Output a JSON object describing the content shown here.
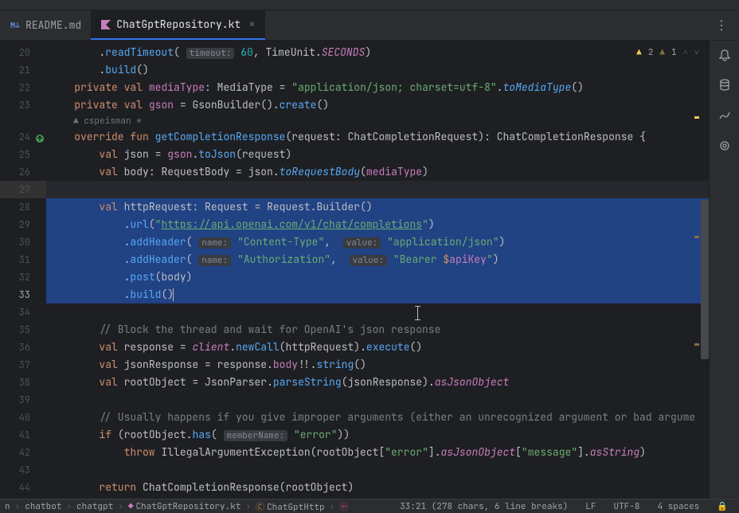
{
  "tabs": [
    {
      "label": "README.md",
      "icon": "M↓"
    },
    {
      "label": "ChatGptRepository.kt",
      "icon": "Kt"
    }
  ],
  "warnings": {
    "warn_count": "2",
    "weak_count": "1"
  },
  "author": {
    "name": "cspeisman",
    "flag": "*"
  },
  "gutter": [
    "20",
    "21",
    "22",
    "23",
    "24",
    "25",
    "26",
    "27",
    "28",
    "29",
    "30",
    "31",
    "32",
    "33",
    "34",
    "35",
    "36",
    "37",
    "38",
    "39",
    "40",
    "41",
    "42",
    "43",
    "44"
  ],
  "code": {
    "l20": {
      "fn": "readTimeout",
      "hint": "timeout:",
      "num": "60",
      "unit": "TimeUnit",
      "const": "SECONDS"
    },
    "l21": {
      "fn": "build"
    },
    "l22": {
      "kw1": "private",
      "kw2": "val",
      "name": "mediaType",
      "type": "MediaType",
      "str": "\"application/json; charset=utf-8\"",
      "ext": "toMediaType"
    },
    "l23": {
      "kw1": "private",
      "kw2": "val",
      "name": "gson",
      "builder": "GsonBuilder",
      "create": "create"
    },
    "l24": {
      "kw1": "override",
      "kw2": "fun",
      "fn": "getCompletionResponse",
      "p1": "request",
      "t1": "ChatCompletionRequest",
      "ret": "ChatCompletionResponse"
    },
    "l25": {
      "kw": "val",
      "name": "json",
      "obj": "gson",
      "fn": "toJson",
      "arg": "request"
    },
    "l26": {
      "kw": "val",
      "name": "body",
      "type": "RequestBody",
      "obj": "json",
      "ext": "toRequestBody",
      "arg": "mediaType"
    },
    "l28": {
      "kw": "val",
      "name": "httpRequest",
      "type": "Request",
      "builder": "Request.Builder"
    },
    "l29": {
      "fn": "url",
      "str": "https://api.openai.com/v1/chat/completions"
    },
    "l30": {
      "fn": "addHeader",
      "h1": "name:",
      "s1": "\"Content-Type\"",
      "h2": "value:",
      "s2": "\"application/json\""
    },
    "l31": {
      "fn": "addHeader",
      "h1": "name:",
      "s1": "\"Authorization\"",
      "h2": "value:",
      "s2a": "\"Bearer ",
      "tmpl": "$",
      "var": "apiKey",
      "s2b": "\""
    },
    "l32": {
      "fn": "post",
      "arg": "body"
    },
    "l33": {
      "fn": "build"
    },
    "l35": {
      "cmt": "// Block the thread and wait for OpenAI's json response"
    },
    "l36": {
      "kw": "val",
      "name": "response",
      "obj": "client",
      "fn1": "newCall",
      "arg": "httpRequest",
      "fn2": "execute"
    },
    "l37": {
      "kw": "val",
      "name": "jsonResponse",
      "obj": "response",
      "prop": "body",
      "nn": "!!",
      "fn": "string"
    },
    "l38": {
      "kw": "val",
      "name": "rootObject",
      "cls": "JsonParser",
      "fn": "parseString",
      "arg": "jsonResponse",
      "ext": "asJsonObject"
    },
    "l40": {
      "cmt": "// Usually happens if you give improper arguments (either an unrecognized argument or bad argume"
    },
    "l41": {
      "kw": "if",
      "obj": "rootObject",
      "fn": "has",
      "hint": "memberName:",
      "str": "\"error\""
    },
    "l42": {
      "kw": "throw",
      "cls": "IllegalArgumentException",
      "obj": "rootObject",
      "s1": "\"error\"",
      "ext1": "asJsonObject",
      "s2": "\"message\"",
      "ext2": "asString"
    },
    "l44": {
      "kw": "return",
      "cls": "ChatCompletionResponse",
      "arg": "rootObject"
    }
  },
  "breadcrumbs": {
    "b1": "n",
    "b2": "chatbot",
    "b3": "chatgpt",
    "b4": "ChatGptRepository.kt",
    "b5": "ChatGptHttp"
  },
  "status": {
    "pos": "33:21 (278 chars, 6 line breaks)",
    "sep": "LF",
    "enc": "UTF-8",
    "indent": "4 spaces"
  }
}
